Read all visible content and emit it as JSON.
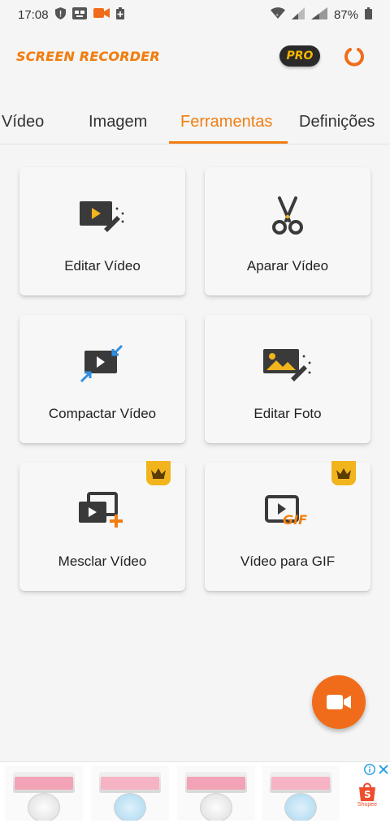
{
  "status_bar": {
    "time": "17:08",
    "battery_percent": "87%",
    "icons": [
      "shield-icon",
      "sim-icon",
      "camera-record-icon",
      "battery-saver-icon",
      "wifi-icon",
      "signal-icon",
      "signal-icon",
      "battery-icon"
    ]
  },
  "header": {
    "app_title": "SCREEN RECORDER",
    "pro_label": "PRO"
  },
  "tabs": [
    {
      "label": "Vídeo",
      "active": false
    },
    {
      "label": "Imagem",
      "active": false
    },
    {
      "label": "Ferramentas",
      "active": true
    },
    {
      "label": "Definições",
      "active": false
    }
  ],
  "tools": [
    {
      "label": "Editar Vídeo",
      "icon": "video-edit-icon",
      "premium": false
    },
    {
      "label": "Aparar Vídeo",
      "icon": "scissors-icon",
      "premium": false
    },
    {
      "label": "Compactar Vídeo",
      "icon": "video-compress-icon",
      "premium": false
    },
    {
      "label": "Editar Foto",
      "icon": "photo-edit-icon",
      "premium": false
    },
    {
      "label": "Mesclar Vídeo",
      "icon": "video-merge-icon",
      "premium": true
    },
    {
      "label": "Vídeo para GIF",
      "icon": "video-to-gif-icon",
      "premium": true
    }
  ],
  "colors": {
    "accent": "#f07e12",
    "fab": "#f06c1a",
    "crown": "#f2b41d",
    "icon_dark": "#3a3a3a",
    "icon_blue": "#2f8fe0"
  },
  "ad": {
    "gif_text": "GIF",
    "shop_label": "Shopee"
  }
}
